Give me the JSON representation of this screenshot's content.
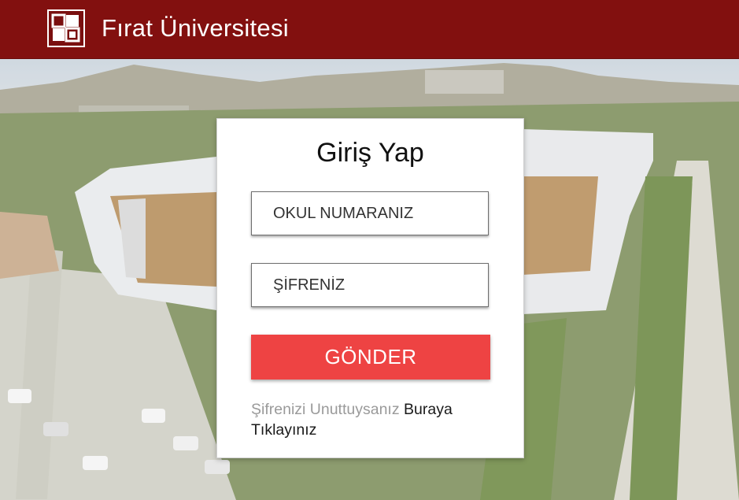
{
  "header": {
    "title": "Fırat Üniversitesi",
    "logo_icon": "university-logo-icon",
    "background_color": "#82100f"
  },
  "login": {
    "title": "Giriş Yap",
    "username_placeholder": "OKUL NUMARANIZ",
    "password_placeholder": "ŞİFRENİZ",
    "submit_label": "GÖNDER",
    "submit_color": "#ee4343",
    "forgot_prefix": "Şifrenizi Unuttuysanız",
    "forgot_link": "Buraya Tıklayınız"
  }
}
